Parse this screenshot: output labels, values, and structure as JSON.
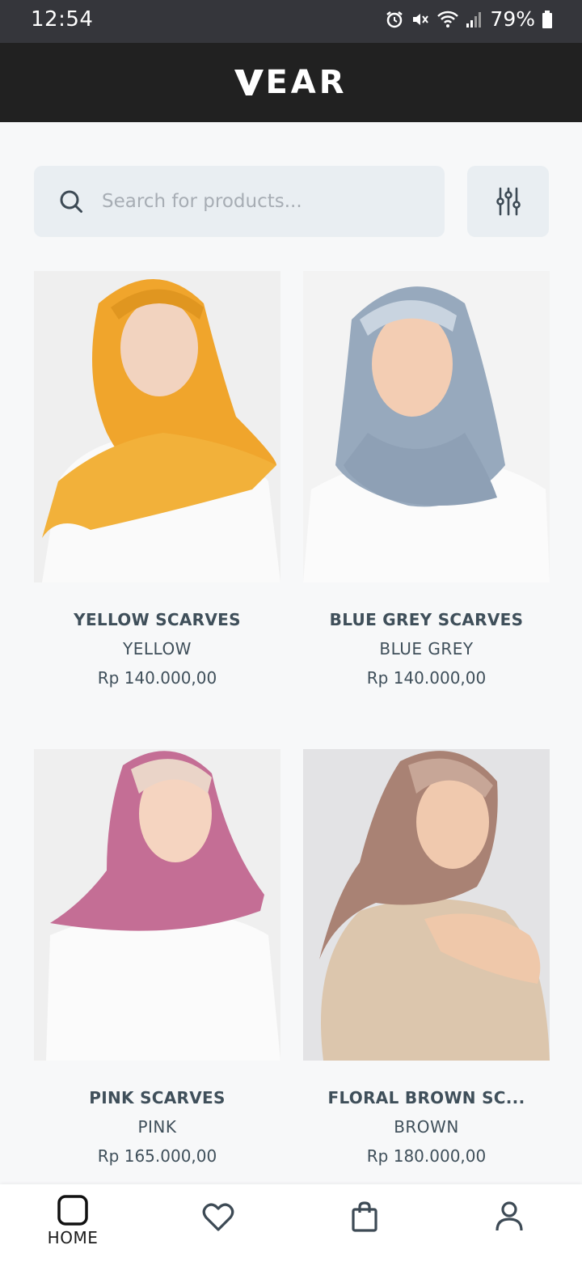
{
  "status_bar": {
    "time": "12:54",
    "battery": "79%",
    "icons": [
      "alarm-icon",
      "mute-icon",
      "wifi-icon",
      "signal-icon",
      "battery-icon"
    ]
  },
  "header": {
    "logo_text": "EAR",
    "background": "#212121"
  },
  "search": {
    "placeholder": "Search for products...",
    "value": ""
  },
  "products": [
    {
      "name": "YELLOW SCARVES",
      "color": "YELLOW",
      "price": "Rp 140.000,00",
      "swatch": "#f0a52c"
    },
    {
      "name": "BLUE GREY SCARVES",
      "color": "BLUE GREY",
      "price": "Rp 140.000,00",
      "swatch": "#97a9bd"
    },
    {
      "name": "PINK SCARVES",
      "color": "PINK",
      "price": "Rp 165.000,00",
      "swatch": "#c46e95"
    },
    {
      "name": "FLORAL BROWN SC...",
      "color": "BROWN",
      "price": "Rp 180.000,00",
      "swatch": "#a98274"
    }
  ],
  "bottom_nav": [
    {
      "label": "HOME",
      "icon": "home-icon",
      "active": true
    },
    {
      "label": "",
      "icon": "heart-icon",
      "active": false
    },
    {
      "label": "",
      "icon": "shopping-bag-icon",
      "active": false
    },
    {
      "label": "",
      "icon": "user-icon",
      "active": false
    }
  ],
  "colors": {
    "text_primary": "#3f4f5a",
    "search_bg": "#e9eef2",
    "page_bg": "#f7f8f9"
  }
}
